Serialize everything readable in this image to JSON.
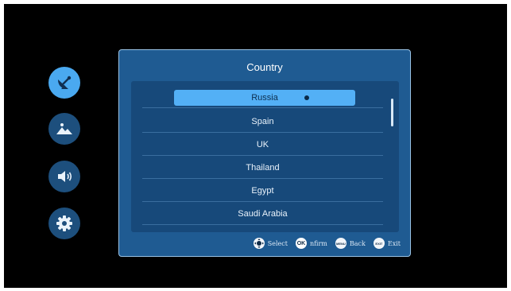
{
  "sidebar": {
    "items": [
      {
        "icon": "satellite-dish-icon",
        "active": true
      },
      {
        "icon": "picture-icon",
        "active": false
      },
      {
        "icon": "speaker-icon",
        "active": false
      },
      {
        "icon": "gear-icon",
        "active": false
      }
    ]
  },
  "dialog": {
    "title": "Country",
    "items": [
      "Russia",
      "Spain",
      "UK",
      "Thailand",
      "Egypt",
      "Saudi Arabia"
    ],
    "selected": "Russia"
  },
  "footer": {
    "select_label": "Select",
    "ok_badge": "OK",
    "confirm_label": "nfirm",
    "menu_badge": "MENU",
    "back_label": "Back",
    "exit_badge": "EXIT",
    "exit_label": "Exit"
  },
  "colors": {
    "accent": "#4aa9f0",
    "panel": "#1f5b92",
    "selected_row": "#53b0f6"
  }
}
